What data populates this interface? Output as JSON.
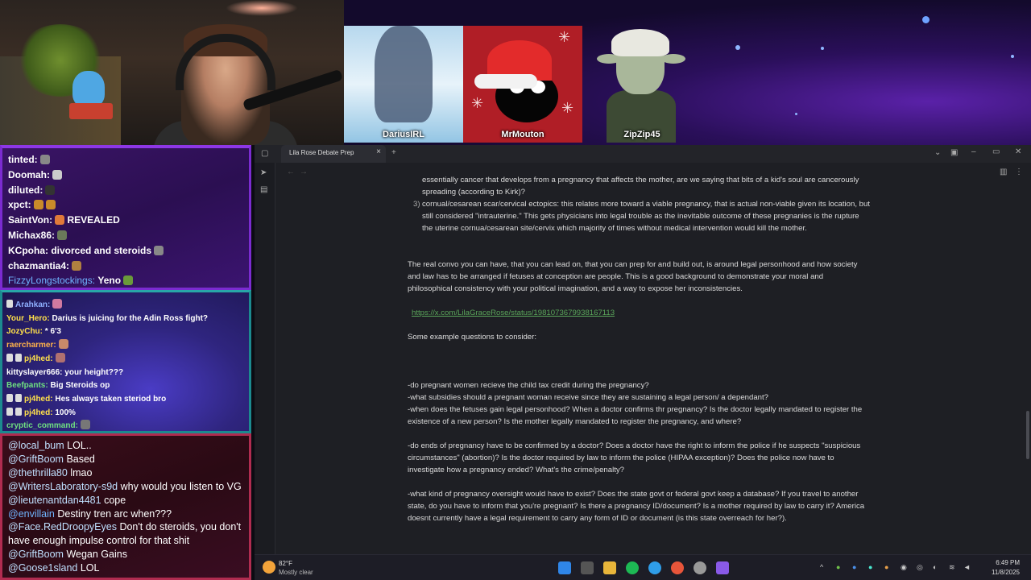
{
  "stream": {
    "guests": [
      {
        "name": "DariusIRL"
      },
      {
        "name": "MrMouton"
      },
      {
        "name": "ZipZip45"
      }
    ]
  },
  "chat_top": [
    {
      "user": "tinted:",
      "msg": ""
    },
    {
      "user": "Doomah:",
      "msg": ""
    },
    {
      "user": "diluted:",
      "msg": ""
    },
    {
      "user": "xpct:",
      "msg": ""
    },
    {
      "user": "SaintVon:",
      "msg": "REVEALED"
    },
    {
      "user": "Michax86:",
      "msg": ""
    },
    {
      "user": "KCpoha:",
      "msg": "divorced and steroids"
    },
    {
      "user": "chazmantia4:",
      "msg": ""
    },
    {
      "user": "FizzyLongstockings:",
      "msg": "Yeno"
    }
  ],
  "chat_mid": [
    {
      "user": "Arahkan:",
      "msg": ""
    },
    {
      "user": "Your_Hero:",
      "msg": "Darius is juicing for the Adin Ross fight?"
    },
    {
      "user": "JozyChu:",
      "msg": "* 6'3"
    },
    {
      "user": "raercharmer:",
      "msg": ""
    },
    {
      "user": "pj4hed:",
      "msg": ""
    },
    {
      "user": "kittyslayer666:",
      "msg": "your height???"
    },
    {
      "user": "Beefpants:",
      "msg": "Big Steroids op"
    },
    {
      "user": "pj4hed:",
      "msg": "Hes always taken steriod bro"
    },
    {
      "user": "pj4hed:",
      "msg": "100%"
    },
    {
      "user": "cryptic_command:",
      "msg": ""
    }
  ],
  "chat_bottom": [
    {
      "user": "@local_bum",
      "msg": "LOL.."
    },
    {
      "user": "@GriftBoom",
      "msg": "Based"
    },
    {
      "user": "@thethrilla80",
      "msg": "lmao"
    },
    {
      "user": "@WritersLaboratory-s9d",
      "msg": "why would you listen to VG"
    },
    {
      "user": "@lieutenantdan4481",
      "msg": "cope"
    },
    {
      "user": "@envillain",
      "msg": "Destiny tren arc when???"
    },
    {
      "user": "@Face.RedDroopyEyes",
      "msg": "Don't do steroids, you don't have enough impulse control for that shit"
    },
    {
      "user": "@GriftBoom",
      "msg": "Wegan Gains"
    },
    {
      "user": "@Goose1sland",
      "msg": "LOL"
    }
  ],
  "browser": {
    "tab_title": "Lila Rose Debate Prep",
    "tab_close": "×",
    "new_tab": "+",
    "doc": {
      "frag_line1": "essentially cancer that develops from a pregnancy that affects the mother, are we saying that bits of a kid's soul are cancerously",
      "frag_line2": "spreading (according to Kirk)?",
      "item3_num": "3)",
      "item3_line1": "cornual/cesarean scar/cervical ectopics: this relates more toward a viable pregnancy, that is actual non-viable given its location, but",
      "item3_line2": "still considered \"intrauterine.\" This gets physicians into legal trouble as the inevitable outcome of these pregnanies is the rupture",
      "item3_line3": "the uterine cornua/cesarean site/cervix which majority of times without medical intervention would kill the mother.",
      "para1_line1": "The real convo you can have, that you can lead on, that you can prep for and build out, is around legal personhood and how society",
      "para1_line2": "and law has to be arranged if fetuses at conception are people. This is a good background to demonstrate your moral and",
      "para1_line3": "philosophical consistency with your political imagination, and a way to expose her inconsistencies.",
      "link": "https://x.com/LilaGraceRose/status/1981073679938167113",
      "examples_heading": "Some example questions to consider:",
      "q1": "-do pregnant women recieve the child tax credit during the pregnancy?",
      "q2": "-what subsidies should a pregnant woman receive since they are sustaining a legal person/ a dependant?",
      "q3_line1": "-when does the fetuses gain legal personhood? When a doctor confirms thr pregnancy? Is the doctor legally mandated to register the",
      "q3_line2": "existence of a new person? Is the mother legally mandated to register the pregnancy, and where?",
      "q4_line1": "-do ends of pregnancy have to be confirmed by a doctor? Does a doctor have the right to inform the police if he suspects \"suspicious",
      "q4_line2": "circumstances\" (abortion)? Is the doctor required by law to inform the police (HIPAA exception)? Does the police now have to",
      "q4_line3": "investigate how a pregnancy ended? What's the crime/penalty?",
      "q5_line1": "-what kind of pregnancy oversight would have to exist? Does the state govt or federal govt keep a database? If you travel to another",
      "q5_line2": "state, do you have to inform that you're pregnant? Is there a pregnancy ID/document? Is a mother required by law to carry it? America",
      "q5_line3": "doesnt currently have a legal requirement to carry any form of ID or document (is this state overreach for her?)."
    }
  },
  "taskbar": {
    "weather_temp": "82°F",
    "weather_desc": "Mostly clear",
    "time": "6:49 PM",
    "date": "11/8/2025"
  },
  "colors": {
    "link": "#5aa55a",
    "chat_top_border": "#7b2bd0",
    "chat_mid_border": "#1c8a8f",
    "chat_bottom_border": "#b02c50"
  }
}
